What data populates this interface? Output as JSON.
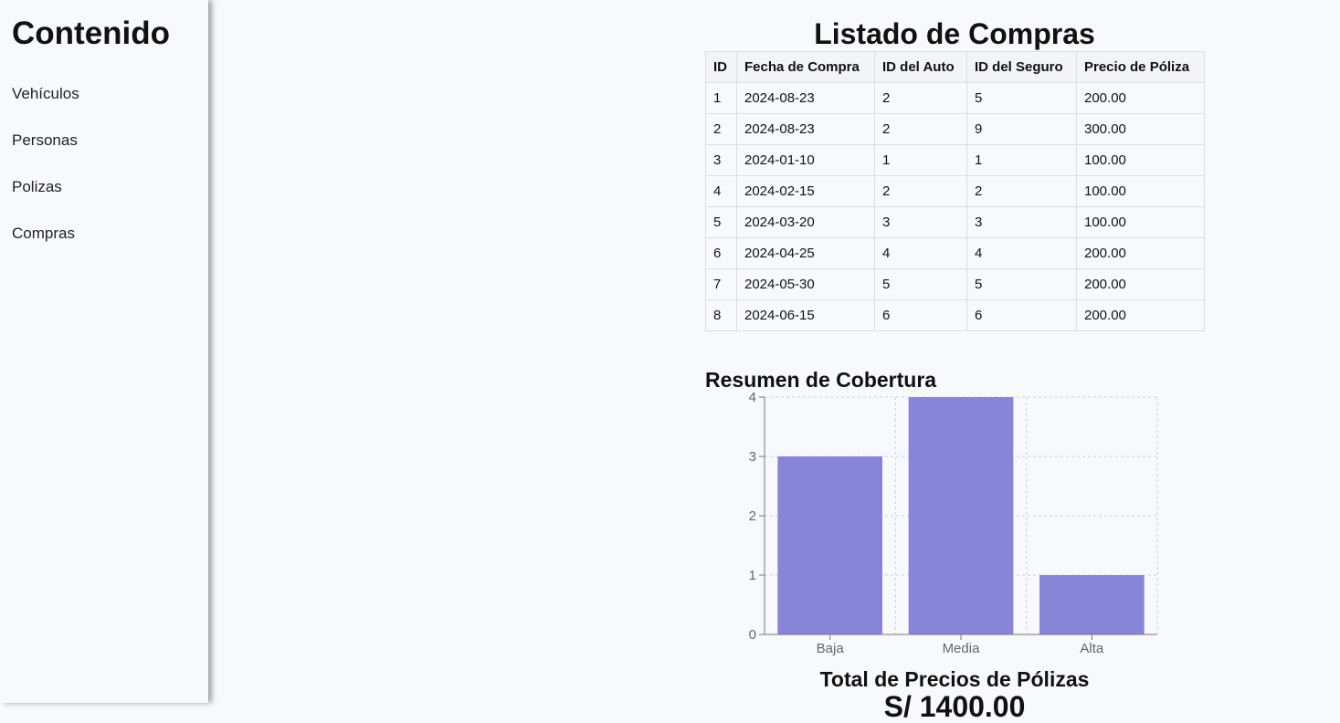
{
  "sidebar": {
    "title": "Contenido",
    "items": [
      {
        "label": "Vehículos"
      },
      {
        "label": "Personas"
      },
      {
        "label": "Polizas"
      },
      {
        "label": "Compras"
      }
    ]
  },
  "main": {
    "title": "Listado de Compras",
    "table": {
      "headers": [
        "ID",
        "Fecha de Compra",
        "ID del Auto",
        "ID del Seguro",
        "Precio de Póliza"
      ],
      "rows": [
        [
          "1",
          "2024-08-23",
          "2",
          "5",
          "200.00"
        ],
        [
          "2",
          "2024-08-23",
          "2",
          "9",
          "300.00"
        ],
        [
          "3",
          "2024-01-10",
          "1",
          "1",
          "100.00"
        ],
        [
          "4",
          "2024-02-15",
          "2",
          "2",
          "100.00"
        ],
        [
          "5",
          "2024-03-20",
          "3",
          "3",
          "100.00"
        ],
        [
          "6",
          "2024-04-25",
          "4",
          "4",
          "200.00"
        ],
        [
          "7",
          "2024-05-30",
          "5",
          "5",
          "200.00"
        ],
        [
          "8",
          "2024-06-15",
          "6",
          "6",
          "200.00"
        ]
      ]
    },
    "total_title": "Total de Precios de Pólizas",
    "total_value": "S/ 1400.00"
  },
  "chart_data": {
    "type": "bar",
    "title": "Resumen de Cobertura",
    "categories": [
      "Baja",
      "Media",
      "Alta"
    ],
    "values": [
      3,
      4,
      1
    ],
    "ylim": [
      0,
      4
    ],
    "yticks": [
      0,
      1,
      2,
      3,
      4
    ],
    "grid": true,
    "bar_color": "#8884d8",
    "xlabel": "",
    "ylabel": ""
  }
}
